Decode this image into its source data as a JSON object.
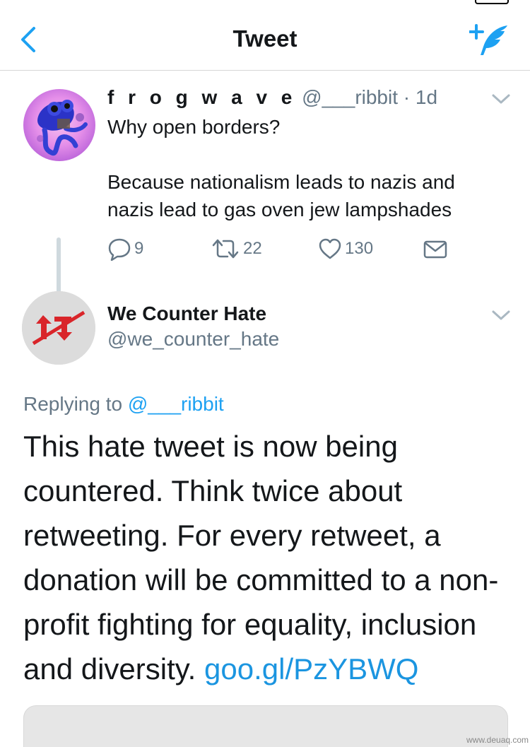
{
  "nav": {
    "title": "Tweet",
    "back_icon": "chevron-left-icon",
    "compose_icon": "compose-tweet-icon"
  },
  "tweet1": {
    "display_name": "f r o g w a v e",
    "handle": "@___ribbit",
    "separator": "·",
    "time": "1d",
    "text_lines": [
      "Why open borders?",
      "",
      "Because nationalism leads to nazis and",
      "nazis lead to gas oven jew lampshades"
    ],
    "reply_count": "9",
    "retweet_count": "22",
    "like_count": "130"
  },
  "tweet2": {
    "display_name": "We Counter Hate",
    "handle": "@we_counter_hate",
    "replying_prefix": "Replying to",
    "replying_handle": "@___ribbit",
    "text": "This hate tweet is now being countered. Think twice about retweeting. For every retweet, a donation will be committed to a non-profit fighting for equality, inclusion and diversity.",
    "link": "goo.gl/PzYBWQ"
  },
  "colors": {
    "accent": "#1da1f2",
    "secondary_text": "#657786",
    "logo_red": "#d9252a"
  },
  "watermark": "www.deuaq.com"
}
